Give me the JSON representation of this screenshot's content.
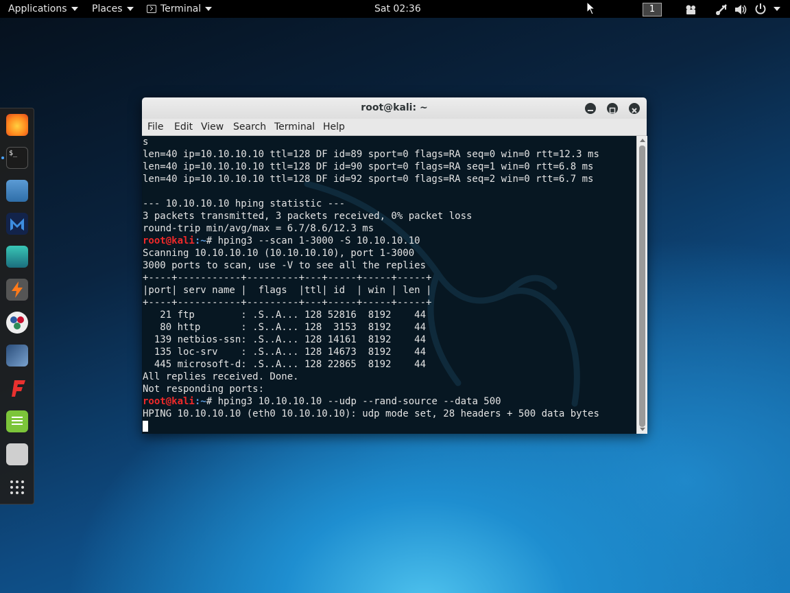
{
  "topbar": {
    "applications": "Applications",
    "places": "Places",
    "terminal": "Terminal",
    "clock": "Sat 02:36",
    "workspace": "1"
  },
  "dock": {
    "items": [
      "firefox-icon",
      "terminal-icon",
      "files-icon",
      "metasploit-icon",
      "armitage-icon",
      "burpsuite-icon",
      "maltego-icon",
      "beef-icon",
      "faraday-icon",
      "leafpad-icon",
      "cutycapt-icon",
      "show-apps-icon"
    ]
  },
  "window": {
    "title": "root@kali: ~",
    "menus": [
      "File",
      "Edit",
      "View",
      "Search",
      "Terminal",
      "Help"
    ]
  },
  "terminal": {
    "lines": [
      "s",
      "len=40 ip=10.10.10.10 ttl=128 DF id=89 sport=0 flags=RA seq=0 win=0 rtt=12.3 ms",
      "len=40 ip=10.10.10.10 ttl=128 DF id=90 sport=0 flags=RA seq=1 win=0 rtt=6.8 ms",
      "len=40 ip=10.10.10.10 ttl=128 DF id=92 sport=0 flags=RA seq=2 win=0 rtt=6.7 ms",
      "",
      "--- 10.10.10.10 hping statistic ---",
      "3 packets transmitted, 3 packets received, 0% packet loss",
      "round-trip min/avg/max = 6.7/8.6/12.3 ms",
      "",
      "Scanning 10.10.10.10 (10.10.10.10), port 1-3000",
      "3000 ports to scan, use -V to see all the replies",
      "+----+-----------+---------+---+-----+-----+-----+",
      "|port| serv name |  flags  |ttl| id  | win | len |",
      "+----+-----------+---------+---+-----+-----+-----+",
      "   21 ftp        : .S..A... 128 52816  8192    44",
      "   80 http       : .S..A... 128  3153  8192    44",
      "  139 netbios-ssn: .S..A... 128 14161  8192    44",
      "  135 loc-srv    : .S..A... 128 14673  8192    44",
      "  445 microsoft-d: .S..A... 128 22865  8192    44",
      "All replies received. Done.",
      "Not responding ports:",
      "",
      "HPING 10.10.10.10 (eth0 10.10.10.10): udp mode set, 28 headers + 500 data bytes"
    ],
    "prompt_user": "root@kali",
    "prompt_path": ":~",
    "prompt_symbol": "# ",
    "commands": [
      "hping3 --scan 1-3000 -S 10.10.10.10",
      "hping3 10.10.10.10 --udp --rand-source --data 500"
    ]
  }
}
